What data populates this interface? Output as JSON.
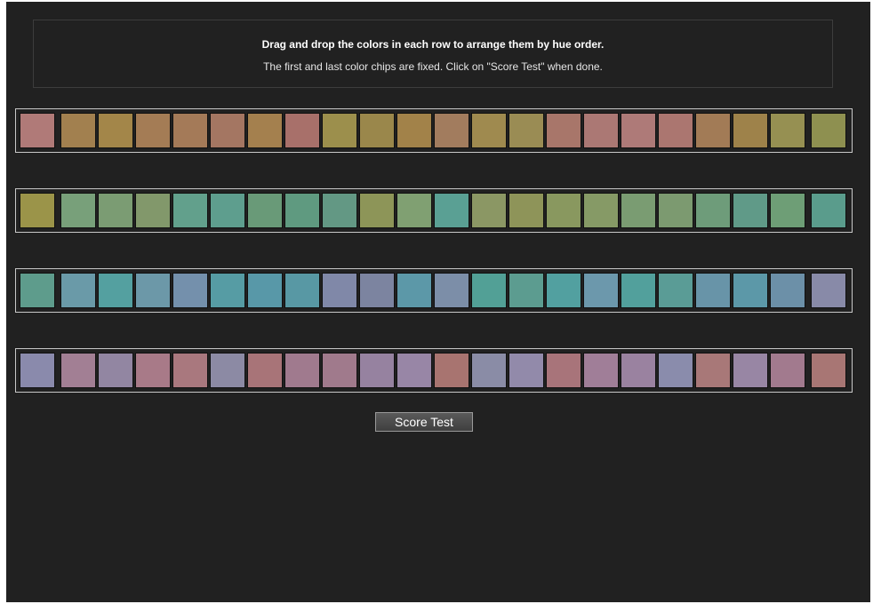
{
  "instructions": {
    "title": "Drag and drop the colors in each row to arrange them by hue order.",
    "subtitle": "The first and last color chips are fixed. Click on \"Score Test\" when done."
  },
  "rows": [
    {
      "chips": [
        "#b07a78",
        "#a2804f",
        "#a38649",
        "#a47c55",
        "#a47a58",
        "#a47662",
        "#a4804e",
        "#a8706a",
        "#9c8f4c",
        "#9a874b",
        "#a28249",
        "#a27c5e",
        "#9f8a4f",
        "#9a8c54",
        "#a8766a",
        "#ab7874",
        "#ae7a78",
        "#ab7670",
        "#a27b56",
        "#9e824a",
        "#969052",
        "#8e9050"
      ]
    },
    {
      "chips": [
        "#9b9449",
        "#78a07a",
        "#7b9c73",
        "#82986b",
        "#62a08c",
        "#5e9e8e",
        "#699a78",
        "#5f9a80",
        "#639884",
        "#8d9558",
        "#80a072",
        "#5aa094",
        "#8b9764",
        "#8e9459",
        "#89985f",
        "#869a66",
        "#7a9c72",
        "#7c9a70",
        "#6e9c7a",
        "#609a88",
        "#6e9e76",
        "#5a9c8c"
      ]
    },
    {
      "chips": [
        "#5e9c8c",
        "#6a9aa8",
        "#54a0a0",
        "#6c98a8",
        "#7490ac",
        "#569ca4",
        "#5898a8",
        "#5898a4",
        "#8088a8",
        "#7c84a0",
        "#5c98a8",
        "#7c8ea8",
        "#52a096",
        "#5c9c90",
        "#52a0a0",
        "#6c98ac",
        "#52a09c",
        "#5a9c96",
        "#6894a8",
        "#5c98a8",
        "#6c90a8",
        "#888aa8"
      ]
    },
    {
      "chips": [
        "#8a8aac",
        "#a27f94",
        "#9286a2",
        "#a87a88",
        "#a9787e",
        "#8c8aa4",
        "#a87478",
        "#a07a8e",
        "#a07a8c",
        "#9682a0",
        "#9886a6",
        "#a87470",
        "#8a8ca6",
        "#928aaa",
        "#a8747a",
        "#a07e98",
        "#9a82a0",
        "#8a8cac",
        "#a87878",
        "#9886a4",
        "#a27a8e",
        "#a87674"
      ]
    }
  ],
  "score_button": {
    "label": "Score Test"
  }
}
